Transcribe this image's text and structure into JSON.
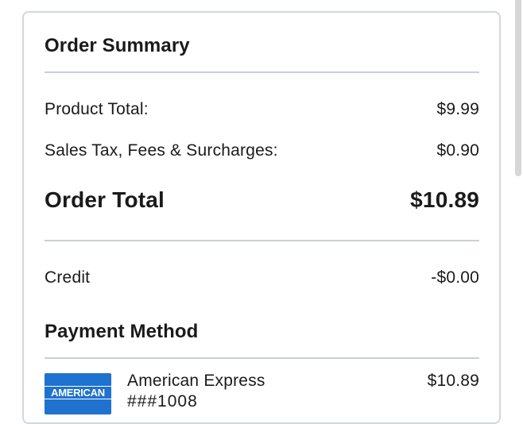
{
  "order_summary": {
    "title": "Order Summary",
    "product_total_label": "Product Total:",
    "product_total_value": "$9.99",
    "tax_label": "Sales Tax, Fees & Surcharges:",
    "tax_value": "$0.90",
    "order_total_label": "Order Total",
    "order_total_value": "$10.89",
    "credit_label": "Credit",
    "credit_value": "-$0.00"
  },
  "payment": {
    "title": "Payment Method",
    "card_brand_logo_text": "AMERICAN",
    "card_name": "American Express",
    "card_number": "###1008",
    "amount": "$10.89"
  },
  "colors": {
    "amex_blue": "#1f72cd",
    "divider": "#c9cfd6",
    "card_border": "#d3d8de"
  }
}
